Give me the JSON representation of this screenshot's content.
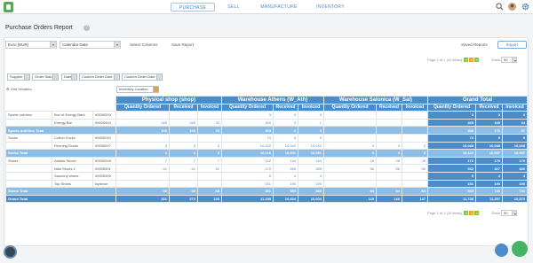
{
  "nav": {
    "items": [
      "PURCHASE",
      "SELL",
      "MANUFACTURE",
      "INVENTORY"
    ]
  },
  "page": {
    "title": "Purchase Orders Report",
    "help": "?"
  },
  "filters": {
    "currency": "Euro (EUR)",
    "period": "Calendar Date",
    "select_columns": "Select Columns",
    "save_report": "Save Report",
    "saved_reports": "Saved Reports",
    "export": "Export"
  },
  "pager": {
    "text": "Page 1 of 1 (20 items)",
    "current": "1",
    "show_label": "Show",
    "show_value": "50"
  },
  "col_chips": [
    "Supplier",
    "Order Status",
    "Date",
    "Custom Order Date 1",
    "Custom Order Date 2"
  ],
  "grid_headers_label": "Grid Headers",
  "location_chip": "Inventory Location",
  "row_chips": [
    "Product Category",
    "Product",
    "SKU"
  ],
  "locations": [
    "Physical shop (shop)",
    "Warehouse Athens (W_Ath)",
    "Warehouse Salonica (W_Sal)",
    "Grand Total"
  ],
  "measures": [
    "Quantity Ordered",
    "Received",
    "Invoiced"
  ],
  "rows": [
    {
      "cat": "Sports nutrition",
      "product": "Box of Energy Bars",
      "sku": "00000003",
      "vals": [
        "",
        "",
        "",
        "3",
        "3",
        "3",
        "",
        "",
        "",
        "3",
        "3",
        "3"
      ]
    },
    {
      "cat": "",
      "product": "Energy Bar",
      "sku": "00000004",
      "vals": [
        "165",
        "165",
        "33",
        "300",
        "3",
        "1",
        "",
        "",
        "",
        "465",
        "168",
        "34"
      ]
    },
    {
      "subtotal": true,
      "cat": "Sports nutrition Total",
      "vals": [
        "165",
        "165",
        "33",
        "303",
        "3",
        "3",
        "",
        "",
        "",
        "468",
        "171",
        "37"
      ]
    },
    {
      "cat": "Socks",
      "product": "Cotton Socks",
      "sku": "00000010",
      "vals": [
        "",
        "",
        "",
        "74",
        "9",
        "9",
        "",
        "",
        "",
        "74",
        "9",
        "9"
      ]
    },
    {
      "cat": "",
      "product": "Running Socks",
      "sku": "00000007",
      "vals": [
        "3",
        "3",
        "3",
        "10,042",
        "10,042",
        "10,042",
        "3",
        "3",
        "3",
        "10,048",
        "10,048",
        "10,048"
      ]
    },
    {
      "subtotal": true,
      "cat": "Socks Total",
      "vals": [
        "3",
        "3",
        "3",
        "10,116",
        "10,051",
        "10,051",
        "3",
        "3",
        "3",
        "10,122",
        "10,057",
        "10,057"
      ]
    },
    {
      "cat": "Shoes",
      "product": "Adidas Shoes",
      "sku": "00000008",
      "vals": [
        "7",
        "7",
        "7",
        "132",
        "144",
        "144",
        "28",
        "28",
        "28",
        "172",
        "179",
        "179"
      ]
    },
    {
      "cat": "",
      "product": "Nike Shoes 1",
      "sku": "00000001",
      "vals": [
        "61",
        "61",
        "61",
        "170",
        "285",
        "285",
        "56",
        "56",
        "56",
        "332",
        "427",
        "426"
      ]
    },
    {
      "cat": "",
      "product": "Saucony shoes",
      "sku": "00000005",
      "vals": [
        "",
        "",
        "",
        "5",
        "4",
        "4",
        "",
        "",
        "",
        "5",
        "4",
        "4"
      ]
    },
    {
      "cat": "",
      "product": "Top Shoes",
      "sku": "topshoe",
      "vals": [
        "",
        "",
        "",
        "151",
        "190",
        "190",
        "",
        "",
        "",
        "151",
        "190",
        "190"
      ]
    },
    {
      "subtotal": true,
      "cat": "Shoes Total",
      "vals": [
        "68",
        "68",
        "68",
        "391",
        "589",
        "589",
        "84",
        "84",
        "84",
        "543",
        "741",
        "741"
      ]
    }
  ],
  "grand_total": {
    "label": "Grand Total",
    "vals": [
      "201",
      "273",
      "139",
      "11,298",
      "10,694",
      "10,604",
      "149",
      "146",
      "147",
      "11,738",
      "11,257",
      "10,870"
    ]
  },
  "colors": {
    "accent": "#4c8cc9",
    "subtotal": "#8bbde6",
    "link": "#4a8bc4"
  }
}
